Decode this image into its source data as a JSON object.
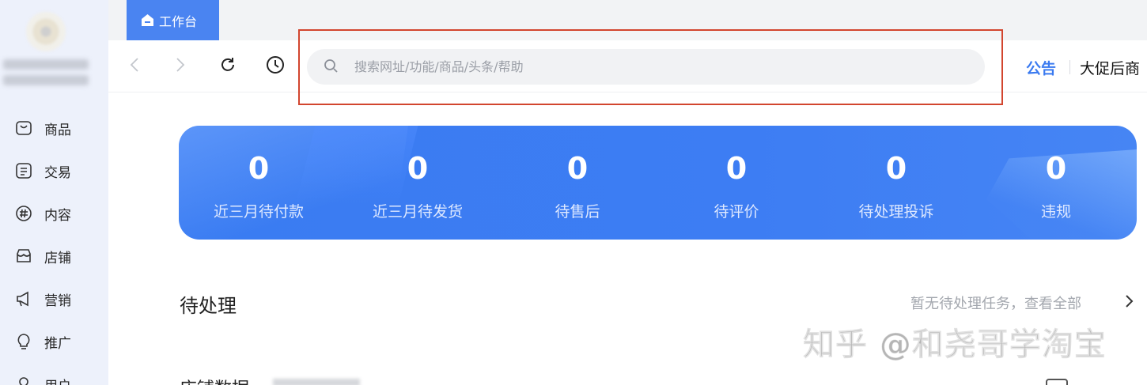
{
  "tabs": {
    "active_label": "工作台"
  },
  "sidebar": {
    "items": [
      {
        "label": "商品",
        "icon": "shopping-bag-icon"
      },
      {
        "label": "交易",
        "icon": "document-list-icon"
      },
      {
        "label": "内容",
        "icon": "hash-circle-icon"
      },
      {
        "label": "店铺",
        "icon": "store-icon"
      },
      {
        "label": "营销",
        "icon": "megaphone-icon"
      },
      {
        "label": "推广",
        "icon": "lightbulb-icon"
      },
      {
        "label": "用户",
        "icon": "user-icon"
      }
    ]
  },
  "toolbar": {
    "search_placeholder": "搜索网址/功能/商品/头条/帮助",
    "notice_label": "公告",
    "notice_text": "大促后商"
  },
  "stats": [
    {
      "value": "0",
      "label": "近三月待付款"
    },
    {
      "value": "0",
      "label": "近三月待发货"
    },
    {
      "value": "0",
      "label": "待售后"
    },
    {
      "value": "0",
      "label": "待评价"
    },
    {
      "value": "0",
      "label": "待处理投诉"
    },
    {
      "value": "0",
      "label": "违规"
    }
  ],
  "pending": {
    "title": "待处理",
    "link": "暂无待处理任务，查看全部"
  },
  "watermark": "知乎 @和尧哥学淘宝",
  "next_section": {
    "title": "店铺数据"
  },
  "colors": {
    "accent": "#3a7af0",
    "banner": "#3d7df3",
    "highlight": "#d2452e",
    "sidebar_bg": "#edf1fb"
  }
}
